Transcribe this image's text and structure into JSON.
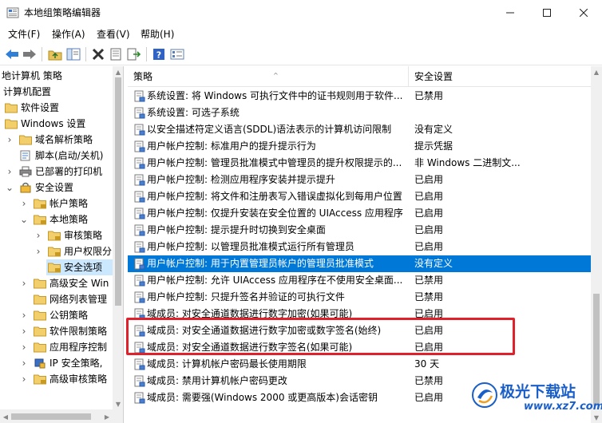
{
  "window": {
    "title": "本地组策略编辑器",
    "controls": {
      "minimize": "minimize",
      "maximize": "maximize",
      "close": "close"
    }
  },
  "menu": [
    {
      "label": "文件(F)"
    },
    {
      "label": "操作(A)"
    },
    {
      "label": "查看(V)"
    },
    {
      "label": "帮助(H)"
    }
  ],
  "toolbar": {
    "buttons": [
      "back-icon",
      "forward-icon",
      "up-folder-icon",
      "show-tree-icon",
      "delete-icon",
      "properties-icon",
      "export-icon",
      "help-icon",
      "filter-icon"
    ]
  },
  "tree": {
    "items": [
      {
        "label": "地计算机 策略"
      },
      {
        "label": "计算机配置"
      },
      {
        "label": "软件设置"
      },
      {
        "label": "Windows 设置"
      },
      {
        "label": "域名解析策略"
      },
      {
        "label": "脚本(启动/关机)"
      },
      {
        "label": "已部署的打印机"
      },
      {
        "label": "安全设置"
      },
      {
        "label": "帐户策略"
      },
      {
        "label": "本地策略"
      },
      {
        "label": "审核策略"
      },
      {
        "label": "用户权限分"
      },
      {
        "label": "安全选项"
      },
      {
        "label": "高级安全 Win"
      },
      {
        "label": "网络列表管理"
      },
      {
        "label": "公钥策略"
      },
      {
        "label": "软件限制策略"
      },
      {
        "label": "应用程序控制"
      },
      {
        "label": "IP 安全策略,"
      },
      {
        "label": "高级审核策略"
      }
    ]
  },
  "list": {
    "columns": {
      "policy": "策略",
      "setting": "安全设置"
    },
    "rows": [
      {
        "name": "系统设置: 将 Windows 可执行文件中的证书规则用于软件...",
        "value": "已禁用"
      },
      {
        "name": "系统设置: 可选子系统",
        "value": ""
      },
      {
        "name": "以安全描述符定义语言(SDDL)语法表示的计算机访问限制",
        "value": "没有定义"
      },
      {
        "name": "用户帐户控制: 标准用户的提升提示行为",
        "value": "提示凭据"
      },
      {
        "name": "用户帐户控制: 管理员批准模式中管理员的提升权限提示的...",
        "value": "非 Windows 二进制文..."
      },
      {
        "name": "用户帐户控制: 检测应用程序安装并提示提升",
        "value": "已启用"
      },
      {
        "name": "用户帐户控制: 将文件和注册表写入错误虚拟化到每用户位置",
        "value": "已启用"
      },
      {
        "name": "用户帐户控制: 仅提升安装在安全位置的 UIAccess 应用程序",
        "value": "已启用"
      },
      {
        "name": "用户帐户控制: 提示提升时切换到安全桌面",
        "value": "已启用"
      },
      {
        "name": "用户帐户控制: 以管理员批准模式运行所有管理员",
        "value": "已启用"
      },
      {
        "name": "用户帐户控制: 用于内置管理员帐户的管理员批准模式",
        "value": "没有定义"
      },
      {
        "name": "用户帐户控制: 允许 UIAccess 应用程序在不使用安全桌面...",
        "value": "已禁用"
      },
      {
        "name": "用户帐户控制: 只提升签名并验证的可执行文件",
        "value": "已禁用"
      },
      {
        "name": "域成员: 对安全通道数据进行数字加密(如果可能)",
        "value": "已启用"
      },
      {
        "name": "域成员: 对安全通道数据进行数字加密或数字签名(始终)",
        "value": "已启用"
      },
      {
        "name": "域成员: 对安全通道数据进行数字签名(如果可能)",
        "value": "已启用"
      },
      {
        "name": "域成员: 计算机帐户密码最长使用期限",
        "value": "30 天"
      },
      {
        "name": "域成员: 禁用计算机帐户密码更改",
        "value": "已禁用"
      },
      {
        "name": "域成员: 需要强(Windows 2000 或更高版本)会话密钥",
        "value": "已启用"
      }
    ]
  },
  "watermark": {
    "name": "极光下载站",
    "url": "www.xz7.com"
  },
  "colors": {
    "selection": "#0078d7",
    "tree_selection": "#cce8ff",
    "highlight_box": "#e0202a",
    "watermark": "#1a5fc9"
  }
}
